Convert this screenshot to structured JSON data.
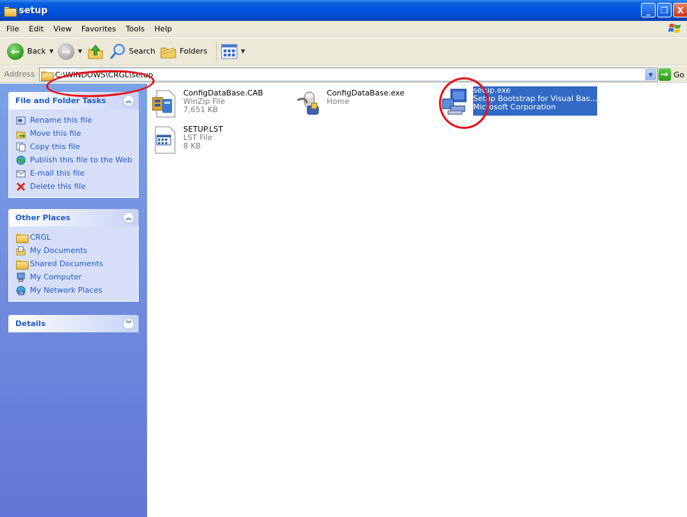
{
  "window": {
    "title": "setup",
    "controls": {
      "minimize": "_",
      "maximize": "❐",
      "close": "X"
    }
  },
  "menu": [
    "File",
    "Edit",
    "View",
    "Favorites",
    "Tools",
    "Help"
  ],
  "toolbar": {
    "back_label": "Back",
    "search_label": "Search",
    "folders_label": "Folders"
  },
  "address": {
    "label": "Address",
    "path": "C:\\WINDOWS\\CRGL\\setup",
    "go_label": "Go"
  },
  "file_tasks": {
    "title": "File and Folder Tasks",
    "items": [
      {
        "label": "Rename this file",
        "icon": "rename-icon"
      },
      {
        "label": "Move this file",
        "icon": "move-icon"
      },
      {
        "label": "Copy this file",
        "icon": "copy-icon"
      },
      {
        "label": "Publish this file to the Web",
        "icon": "publish-web-icon"
      },
      {
        "label": "E-mail this file",
        "icon": "email-icon"
      },
      {
        "label": "Delete this file",
        "icon": "delete-icon"
      }
    ]
  },
  "other_places": {
    "title": "Other Places",
    "items": [
      {
        "label": "CRGL",
        "icon": "folder-icon"
      },
      {
        "label": "My Documents",
        "icon": "my-documents-icon"
      },
      {
        "label": "Shared Documents",
        "icon": "folder-icon"
      },
      {
        "label": "My Computer",
        "icon": "my-computer-icon"
      },
      {
        "label": "My Network Places",
        "icon": "network-icon"
      }
    ]
  },
  "details": {
    "title": "Details"
  },
  "files": [
    {
      "name": "ConfigDataBase.CAB",
      "line2": "WinZip File",
      "line3": "7,651 KB",
      "icon": "winzip-cab-icon",
      "selected": false
    },
    {
      "name": "ConfigDataBase.exe",
      "line2": "Home",
      "line3": "",
      "icon": "installer-exe-icon",
      "selected": false
    },
    {
      "name": "setup.exe",
      "line2": "Setup Bootstrap for Visual Bas...",
      "line3": "Microsoft Corporation",
      "icon": "setup-computer-icon",
      "selected": true
    },
    {
      "name": "SETUP.LST",
      "line2": "LST File",
      "line3": "8 KB",
      "icon": "lst-file-icon",
      "selected": false
    }
  ],
  "colors": {
    "titlebar": "#0054e3",
    "sidepane": "#6f8fdf",
    "link": "#215dc6",
    "selection": "#316ac5",
    "annotation": "#e8101a"
  }
}
